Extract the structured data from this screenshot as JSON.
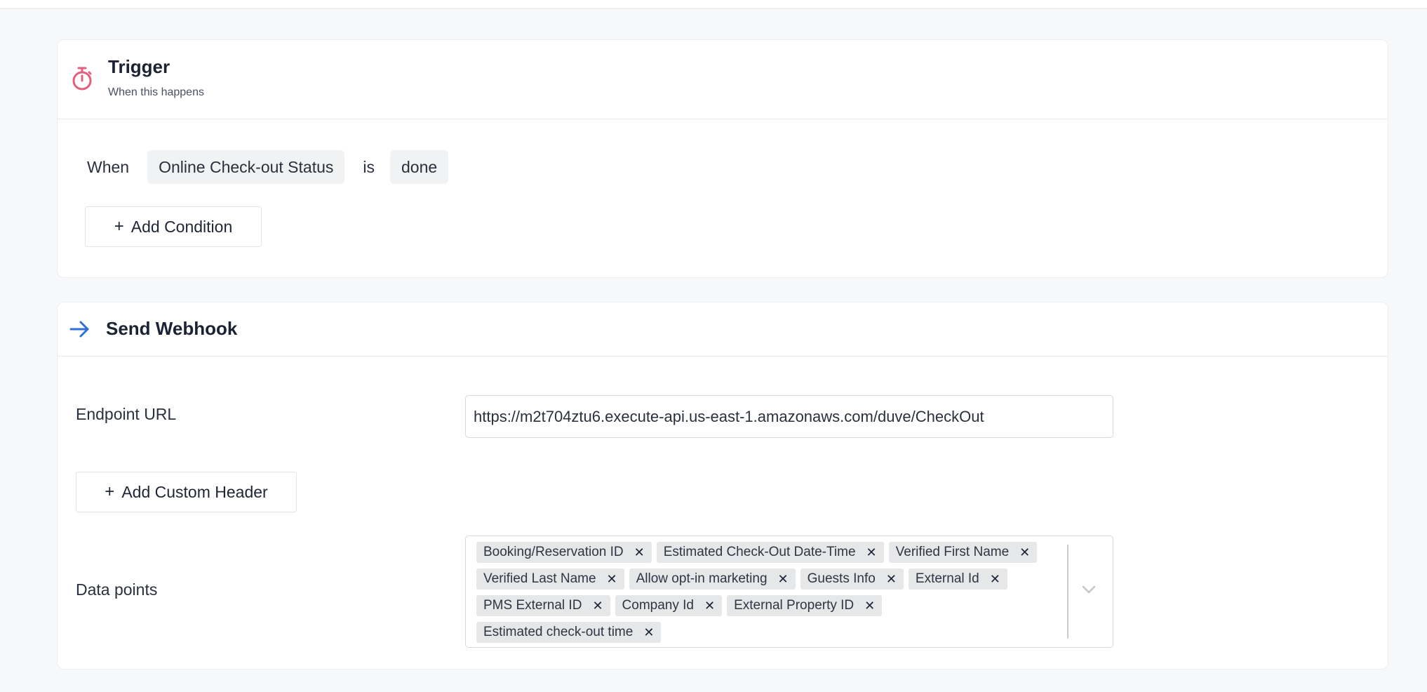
{
  "trigger": {
    "title": "Trigger",
    "subtitle": "When this happens",
    "condition": {
      "when_label": "When",
      "field": "Online Check-out Status",
      "operator": "is",
      "value": "done"
    },
    "add_condition_label": "Add Condition"
  },
  "webhook": {
    "title": "Send Webhook",
    "endpoint_label": "Endpoint URL",
    "endpoint_value": "https://m2t704ztu6.execute-api.us-east-1.amazonaws.com/duve/CheckOut",
    "add_header_label": "Add Custom Header",
    "data_points_label": "Data points",
    "data_points": [
      "Booking/Reservation ID",
      "Estimated Check-Out Date-Time",
      "Verified First Name",
      "Verified Last Name",
      "Allow opt-in marketing",
      "Guests Info",
      "External Id",
      "PMS External ID",
      "Company Id",
      "External Property ID",
      "Estimated check-out time"
    ]
  },
  "icons": {
    "trigger_icon": "timer-icon",
    "webhook_icon": "arrow-right-icon",
    "remove_icon": "close-icon",
    "dropdown_icon": "chevron-down-icon"
  },
  "colors": {
    "trigger_icon": "#e0607e",
    "webhook_icon": "#2f6fd6"
  }
}
